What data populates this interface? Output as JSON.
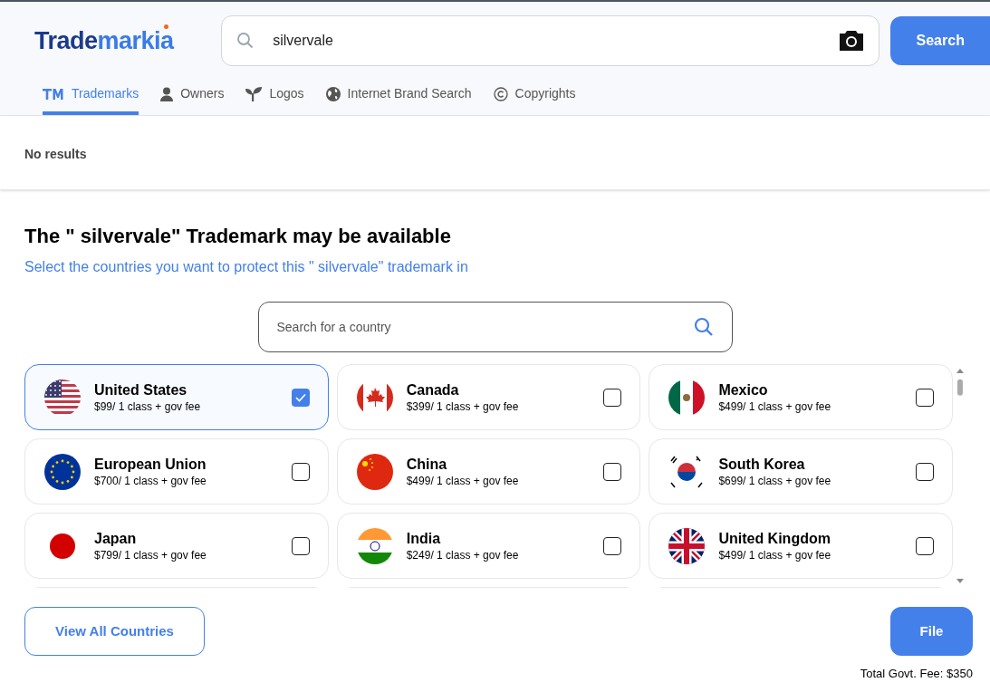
{
  "logo": {
    "part_1": "Trade",
    "part_2": "markia"
  },
  "search": {
    "value": "silvervale",
    "button": "Search"
  },
  "tabs": [
    {
      "label": "Trademarks",
      "selected": true
    },
    {
      "label": "Owners",
      "selected": false
    },
    {
      "label": "Logos",
      "selected": false
    },
    {
      "label": "Internet Brand Search",
      "selected": false
    },
    {
      "label": "Copyrights",
      "selected": false
    }
  ],
  "results_status": "No results",
  "heading": "The \" silvervale\" Trademark may be available",
  "subheading": "Select the countries you want to protect this \" silvervale\" trademark in",
  "country_search": {
    "placeholder": "Search for a country"
  },
  "countries": [
    {
      "name": "United States",
      "price": "$99/ 1 class + gov fee",
      "checked": true
    },
    {
      "name": "Canada",
      "price": "$399/ 1 class + gov fee",
      "checked": false
    },
    {
      "name": "Mexico",
      "price": "$499/ 1 class + gov fee",
      "checked": false
    },
    {
      "name": "European Union",
      "price": "$700/ 1 class + gov fee",
      "checked": false
    },
    {
      "name": "China",
      "price": "$499/ 1 class + gov fee",
      "checked": false
    },
    {
      "name": "South Korea",
      "price": "$699/ 1 class + gov fee",
      "checked": false
    },
    {
      "name": "Japan",
      "price": "$799/ 1 class + gov fee",
      "checked": false
    },
    {
      "name": "India",
      "price": "$249/ 1 class + gov fee",
      "checked": false
    },
    {
      "name": "United Kingdom",
      "price": "$499/ 1 class + gov fee",
      "checked": false
    }
  ],
  "view_all_button": "View All Countries",
  "file_button": "File",
  "total_fee": "Total Govt. Fee: $350"
}
